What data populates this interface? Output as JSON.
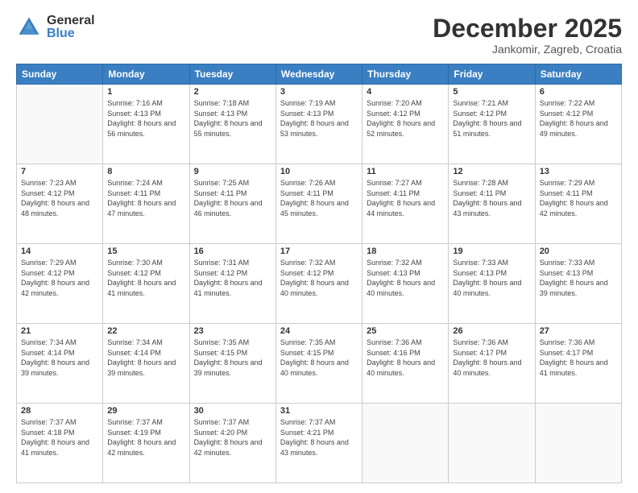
{
  "logo": {
    "general": "General",
    "blue": "Blue"
  },
  "header": {
    "month": "December 2025",
    "location": "Jankomir, Zagreb, Croatia"
  },
  "weekdays": [
    "Sunday",
    "Monday",
    "Tuesday",
    "Wednesday",
    "Thursday",
    "Friday",
    "Saturday"
  ],
  "weeks": [
    [
      {
        "day": "",
        "sunrise": "",
        "sunset": "",
        "daylight": ""
      },
      {
        "day": "1",
        "sunrise": "Sunrise: 7:16 AM",
        "sunset": "Sunset: 4:13 PM",
        "daylight": "Daylight: 8 hours and 56 minutes."
      },
      {
        "day": "2",
        "sunrise": "Sunrise: 7:18 AM",
        "sunset": "Sunset: 4:13 PM",
        "daylight": "Daylight: 8 hours and 55 minutes."
      },
      {
        "day": "3",
        "sunrise": "Sunrise: 7:19 AM",
        "sunset": "Sunset: 4:13 PM",
        "daylight": "Daylight: 8 hours and 53 minutes."
      },
      {
        "day": "4",
        "sunrise": "Sunrise: 7:20 AM",
        "sunset": "Sunset: 4:12 PM",
        "daylight": "Daylight: 8 hours and 52 minutes."
      },
      {
        "day": "5",
        "sunrise": "Sunrise: 7:21 AM",
        "sunset": "Sunset: 4:12 PM",
        "daylight": "Daylight: 8 hours and 51 minutes."
      },
      {
        "day": "6",
        "sunrise": "Sunrise: 7:22 AM",
        "sunset": "Sunset: 4:12 PM",
        "daylight": "Daylight: 8 hours and 49 minutes."
      }
    ],
    [
      {
        "day": "7",
        "sunrise": "Sunrise: 7:23 AM",
        "sunset": "Sunset: 4:12 PM",
        "daylight": "Daylight: 8 hours and 48 minutes."
      },
      {
        "day": "8",
        "sunrise": "Sunrise: 7:24 AM",
        "sunset": "Sunset: 4:11 PM",
        "daylight": "Daylight: 8 hours and 47 minutes."
      },
      {
        "day": "9",
        "sunrise": "Sunrise: 7:25 AM",
        "sunset": "Sunset: 4:11 PM",
        "daylight": "Daylight: 8 hours and 46 minutes."
      },
      {
        "day": "10",
        "sunrise": "Sunrise: 7:26 AM",
        "sunset": "Sunset: 4:11 PM",
        "daylight": "Daylight: 8 hours and 45 minutes."
      },
      {
        "day": "11",
        "sunrise": "Sunrise: 7:27 AM",
        "sunset": "Sunset: 4:11 PM",
        "daylight": "Daylight: 8 hours and 44 minutes."
      },
      {
        "day": "12",
        "sunrise": "Sunrise: 7:28 AM",
        "sunset": "Sunset: 4:11 PM",
        "daylight": "Daylight: 8 hours and 43 minutes."
      },
      {
        "day": "13",
        "sunrise": "Sunrise: 7:29 AM",
        "sunset": "Sunset: 4:11 PM",
        "daylight": "Daylight: 8 hours and 42 minutes."
      }
    ],
    [
      {
        "day": "14",
        "sunrise": "Sunrise: 7:29 AM",
        "sunset": "Sunset: 4:12 PM",
        "daylight": "Daylight: 8 hours and 42 minutes."
      },
      {
        "day": "15",
        "sunrise": "Sunrise: 7:30 AM",
        "sunset": "Sunset: 4:12 PM",
        "daylight": "Daylight: 8 hours and 41 minutes."
      },
      {
        "day": "16",
        "sunrise": "Sunrise: 7:31 AM",
        "sunset": "Sunset: 4:12 PM",
        "daylight": "Daylight: 8 hours and 41 minutes."
      },
      {
        "day": "17",
        "sunrise": "Sunrise: 7:32 AM",
        "sunset": "Sunset: 4:12 PM",
        "daylight": "Daylight: 8 hours and 40 minutes."
      },
      {
        "day": "18",
        "sunrise": "Sunrise: 7:32 AM",
        "sunset": "Sunset: 4:13 PM",
        "daylight": "Daylight: 8 hours and 40 minutes."
      },
      {
        "day": "19",
        "sunrise": "Sunrise: 7:33 AM",
        "sunset": "Sunset: 4:13 PM",
        "daylight": "Daylight: 8 hours and 40 minutes."
      },
      {
        "day": "20",
        "sunrise": "Sunrise: 7:33 AM",
        "sunset": "Sunset: 4:13 PM",
        "daylight": "Daylight: 8 hours and 39 minutes."
      }
    ],
    [
      {
        "day": "21",
        "sunrise": "Sunrise: 7:34 AM",
        "sunset": "Sunset: 4:14 PM",
        "daylight": "Daylight: 8 hours and 39 minutes."
      },
      {
        "day": "22",
        "sunrise": "Sunrise: 7:34 AM",
        "sunset": "Sunset: 4:14 PM",
        "daylight": "Daylight: 8 hours and 39 minutes."
      },
      {
        "day": "23",
        "sunrise": "Sunrise: 7:35 AM",
        "sunset": "Sunset: 4:15 PM",
        "daylight": "Daylight: 8 hours and 39 minutes."
      },
      {
        "day": "24",
        "sunrise": "Sunrise: 7:35 AM",
        "sunset": "Sunset: 4:15 PM",
        "daylight": "Daylight: 8 hours and 40 minutes."
      },
      {
        "day": "25",
        "sunrise": "Sunrise: 7:36 AM",
        "sunset": "Sunset: 4:16 PM",
        "daylight": "Daylight: 8 hours and 40 minutes."
      },
      {
        "day": "26",
        "sunrise": "Sunrise: 7:36 AM",
        "sunset": "Sunset: 4:17 PM",
        "daylight": "Daylight: 8 hours and 40 minutes."
      },
      {
        "day": "27",
        "sunrise": "Sunrise: 7:36 AM",
        "sunset": "Sunset: 4:17 PM",
        "daylight": "Daylight: 8 hours and 41 minutes."
      }
    ],
    [
      {
        "day": "28",
        "sunrise": "Sunrise: 7:37 AM",
        "sunset": "Sunset: 4:18 PM",
        "daylight": "Daylight: 8 hours and 41 minutes."
      },
      {
        "day": "29",
        "sunrise": "Sunrise: 7:37 AM",
        "sunset": "Sunset: 4:19 PM",
        "daylight": "Daylight: 8 hours and 42 minutes."
      },
      {
        "day": "30",
        "sunrise": "Sunrise: 7:37 AM",
        "sunset": "Sunset: 4:20 PM",
        "daylight": "Daylight: 8 hours and 42 minutes."
      },
      {
        "day": "31",
        "sunrise": "Sunrise: 7:37 AM",
        "sunset": "Sunset: 4:21 PM",
        "daylight": "Daylight: 8 hours and 43 minutes."
      },
      {
        "day": "",
        "sunrise": "",
        "sunset": "",
        "daylight": ""
      },
      {
        "day": "",
        "sunrise": "",
        "sunset": "",
        "daylight": ""
      },
      {
        "day": "",
        "sunrise": "",
        "sunset": "",
        "daylight": ""
      }
    ]
  ]
}
